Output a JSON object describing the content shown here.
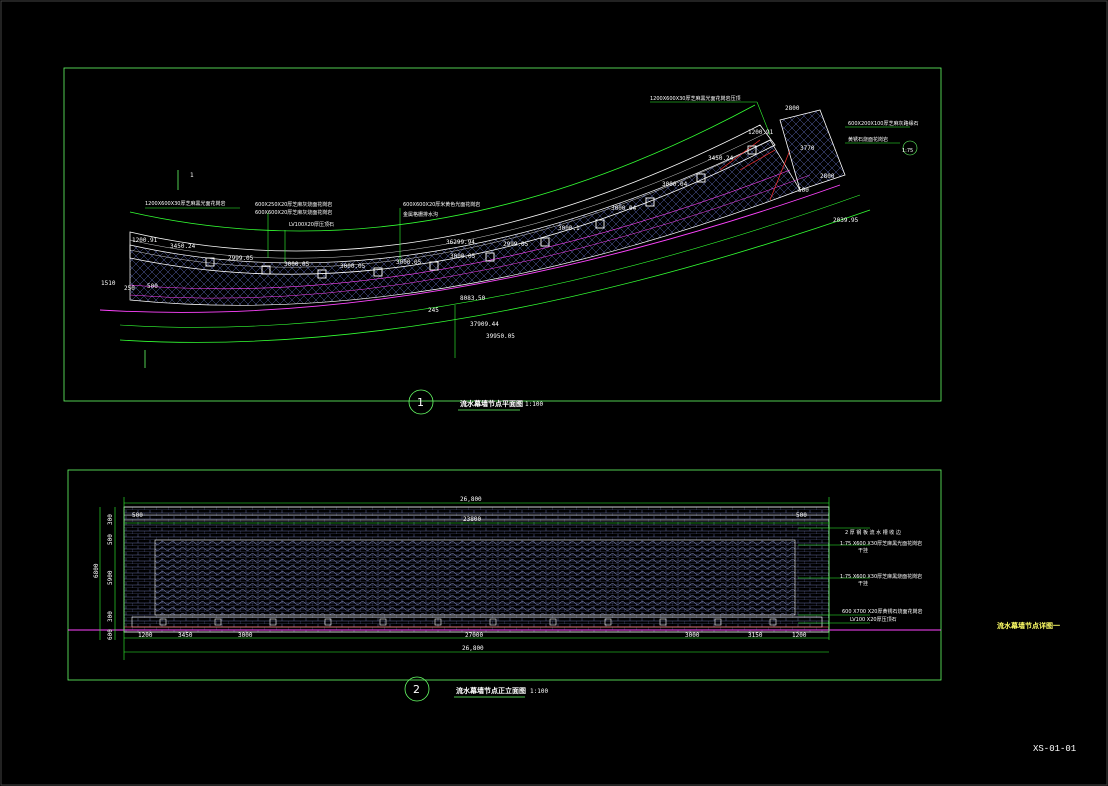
{
  "colors": {
    "frame": "#66ff66",
    "brick": "#8fa0ff",
    "water": "#ff44ff",
    "red": "#ff3030",
    "green": "#33ff33",
    "white": "#ffffff",
    "yellow": "#ffff66"
  },
  "sheet_number": "XS-01-01",
  "side_title": "流水幕墙节点详图一",
  "plan": {
    "bubble": "1",
    "title": "流水幕墙节点平面图",
    "scale": "1:100",
    "section_mark": "1",
    "notes": [
      "1200X600X30厚芝麻黑光面花岗岩",
      "600X250X20厚芝麻灰烧面花岗岩",
      "600X600X20厚芝麻灰烧面花岗岩",
      "LV100X20厚压顶石",
      "600X600X20厚米黄色光面花岗岩",
      "金属格栅排水沟",
      "1200X600X30厚芝麻黑光面花岗岩压顶",
      "600X200X100厚芝麻灰路缘石",
      "黄锈石烧面花岗岩",
      "1:75"
    ],
    "dims": [
      "3450.24",
      "2999.05",
      "3000.05",
      "3000.05",
      "3000.05",
      "3000.05",
      "2999.05",
      "3000.1",
      "3000.04",
      "3000.04",
      "3450.24",
      "1200.91",
      "1200.91",
      "2800",
      "3770",
      "2800",
      "2039.95",
      "500",
      "36299.94",
      "37909.44",
      "39950.05",
      "1510",
      "250",
      "500",
      "8083.50",
      "245"
    ]
  },
  "elevation": {
    "bubble": "2",
    "title": "流水幕墙节点正立面图",
    "scale": "1:100",
    "dims_top": [
      "26,800",
      "23800",
      "500",
      "500"
    ],
    "dims_bottom": [
      "1200",
      "3450",
      "3000",
      "27000",
      "3000",
      "3150",
      "1200",
      "26,800"
    ],
    "dims_left": [
      "300",
      "500",
      "6800",
      "5900",
      "300",
      "600"
    ],
    "notes": [
      "2 厚 钢 板 流 水 槽 收 边",
      "1:75 X600 X30厚芝麻黑光面花岗岩",
      "干挂",
      "1:75 X600 X30厚芝麻黑烧面花岗岩",
      "干挂",
      "600 X700 X20厚黄锈石烧面花岗岩",
      "LV100 X20厚压顶石"
    ]
  }
}
